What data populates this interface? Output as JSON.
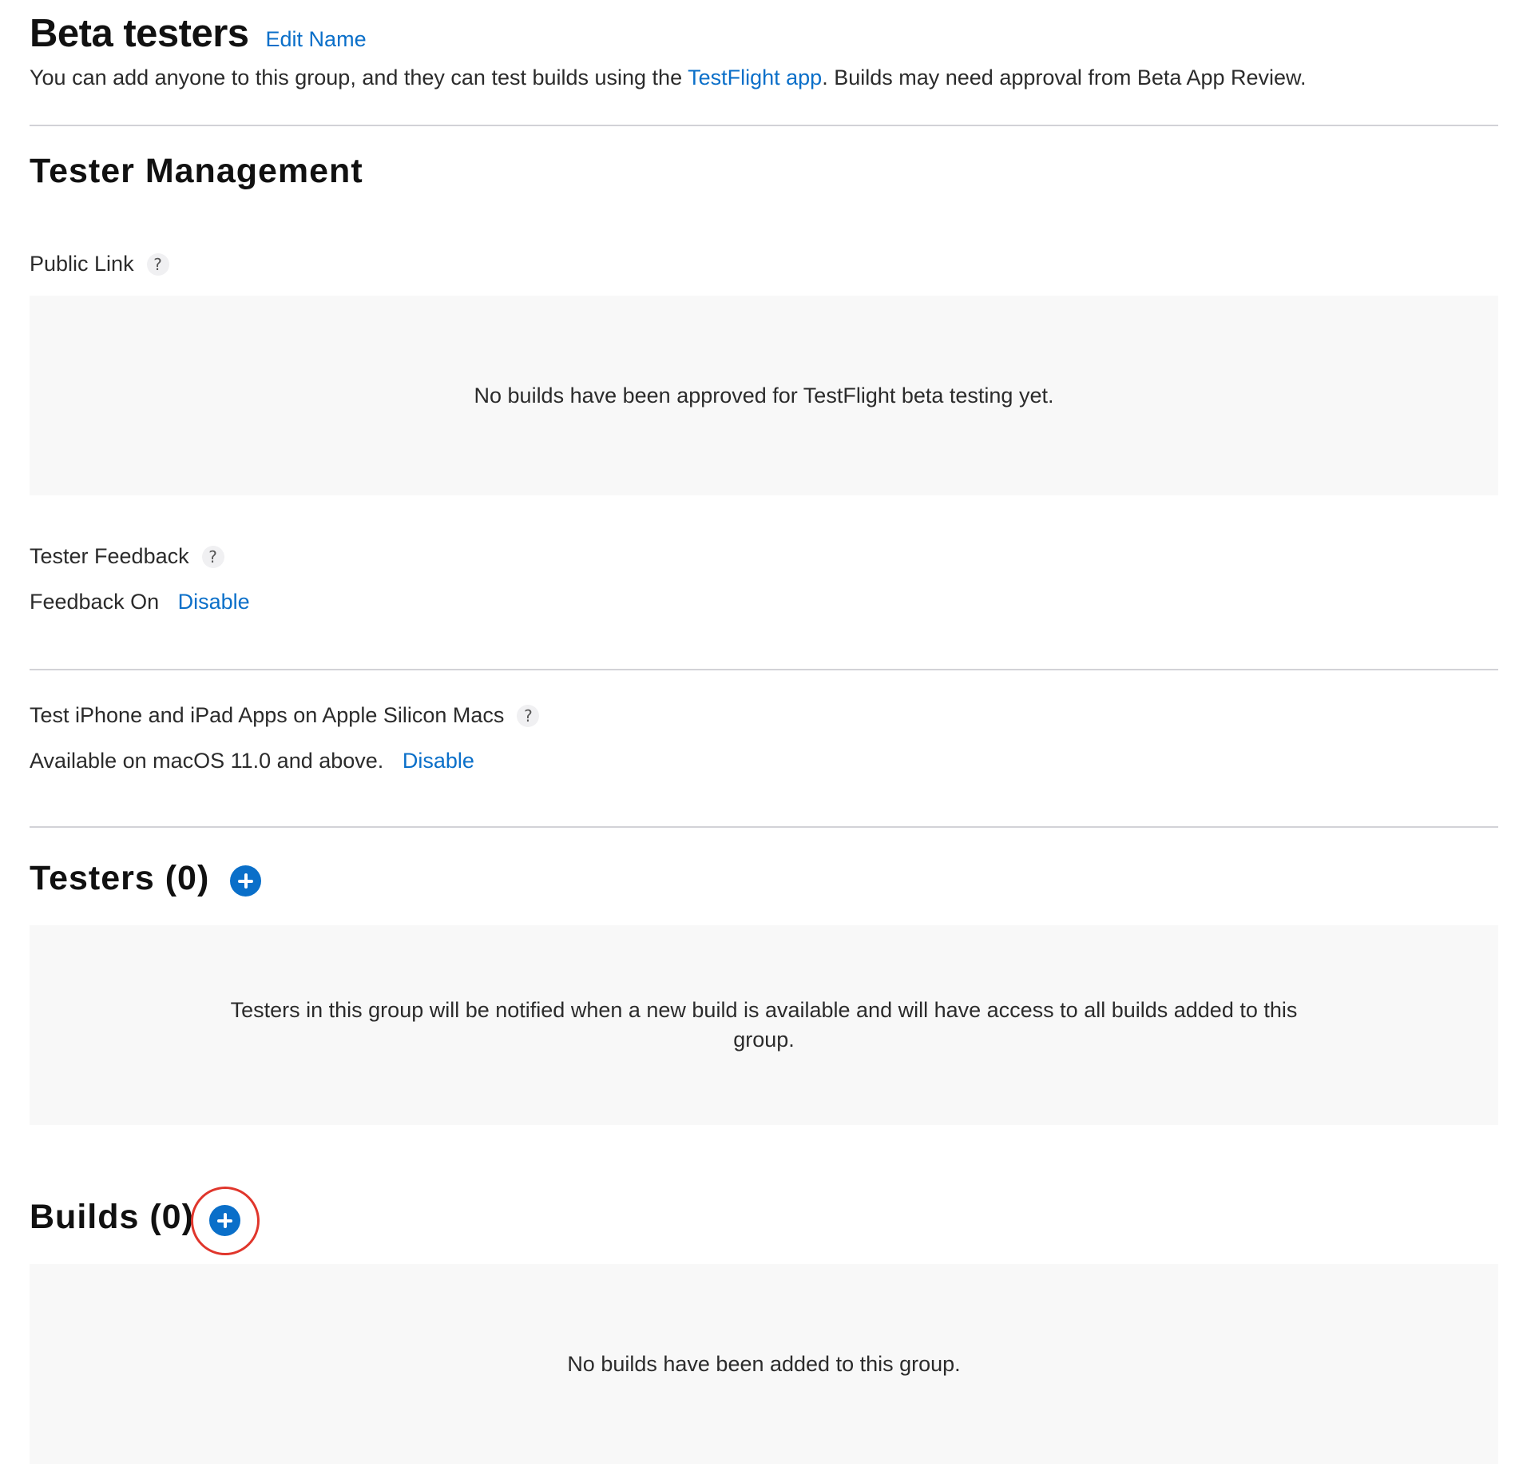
{
  "header": {
    "title": "Beta testers",
    "edit_name_label": "Edit Name",
    "intro_before": "You can add anyone to this group, and they can test builds using the ",
    "intro_link": "TestFlight app",
    "intro_after": ". Builds may need approval from Beta App Review."
  },
  "tester_management": {
    "title": "Tester Management",
    "public_link": {
      "label": "Public Link",
      "help": "?",
      "empty_message": "No builds have been approved for TestFlight beta testing yet."
    },
    "tester_feedback": {
      "label": "Tester Feedback",
      "help": "?",
      "status": "Feedback On",
      "action": "Disable"
    },
    "apple_silicon": {
      "label": "Test iPhone and iPad Apps on Apple Silicon Macs",
      "help": "?",
      "status": "Available on macOS 11.0 and above.",
      "action": "Disable"
    }
  },
  "testers": {
    "title": "Testers (0)",
    "add_icon": "plus-circle-icon",
    "empty_message": "Testers in this group will be notified when a new build is available and will have access to all builds added to this group."
  },
  "builds": {
    "title": "Builds (0)",
    "add_icon": "plus-circle-icon",
    "empty_message": "No builds have been added to this group."
  },
  "colors": {
    "accent": "#0a6fc9",
    "highlight": "#e0362c",
    "panel_background": "#f8f8f8",
    "divider": "#d2d2d7"
  }
}
